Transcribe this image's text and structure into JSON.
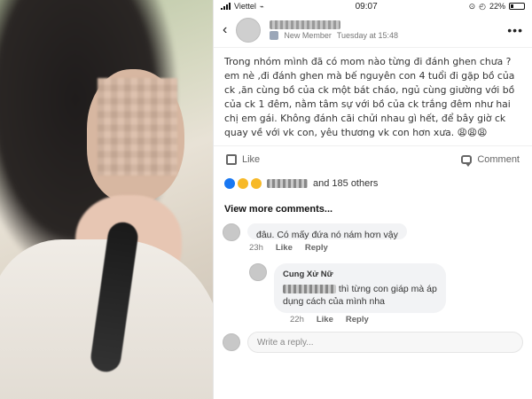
{
  "status": {
    "carrier": "Viettel",
    "time": "09:07",
    "battery": "22%"
  },
  "header": {
    "badge_text": "New Member",
    "timestamp": "Tuesday at 15:48",
    "more_label": "•••"
  },
  "post": {
    "lines": [
      "Trong nhóm mình đã có mom nào từng đi đánh ghen chưa ?",
      "em nè ,đi đánh ghen mà bế nguyên con 4 tuổi đi gặp bồ của",
      "ck ,ăn cùng bồ của ck một bát cháo, ngủ cùng giường với bồ",
      "của ck 1 đêm, nằm tâm sự với bồ của ck trắng đêm như hai",
      "chị em gái.  Không đánh cãi chửi nhau gì hết, để bây giờ ck",
      "quay về với vk con, yêu thương vk con hơn xưa."
    ],
    "emoji_suffix": "😩😩😩"
  },
  "actions": {
    "like_label": "Like",
    "comment_label": "Comment"
  },
  "reactions": {
    "others_text": "and 185 others"
  },
  "comments": {
    "view_more": "View more comments...",
    "c1": {
      "text": "đâu. Có mấy đứa nó nám hơn vậy",
      "time": "23h",
      "like": "Like",
      "reply": "Reply"
    },
    "c2": {
      "author": "Cung Xử Nữ",
      "text_line1": "thì từng con giáp mà áp",
      "text_line2": "dụng cách của mình nha",
      "time": "22h",
      "like": "Like",
      "reply": "Reply"
    }
  },
  "reply_box": {
    "placeholder": "Write a reply..."
  }
}
